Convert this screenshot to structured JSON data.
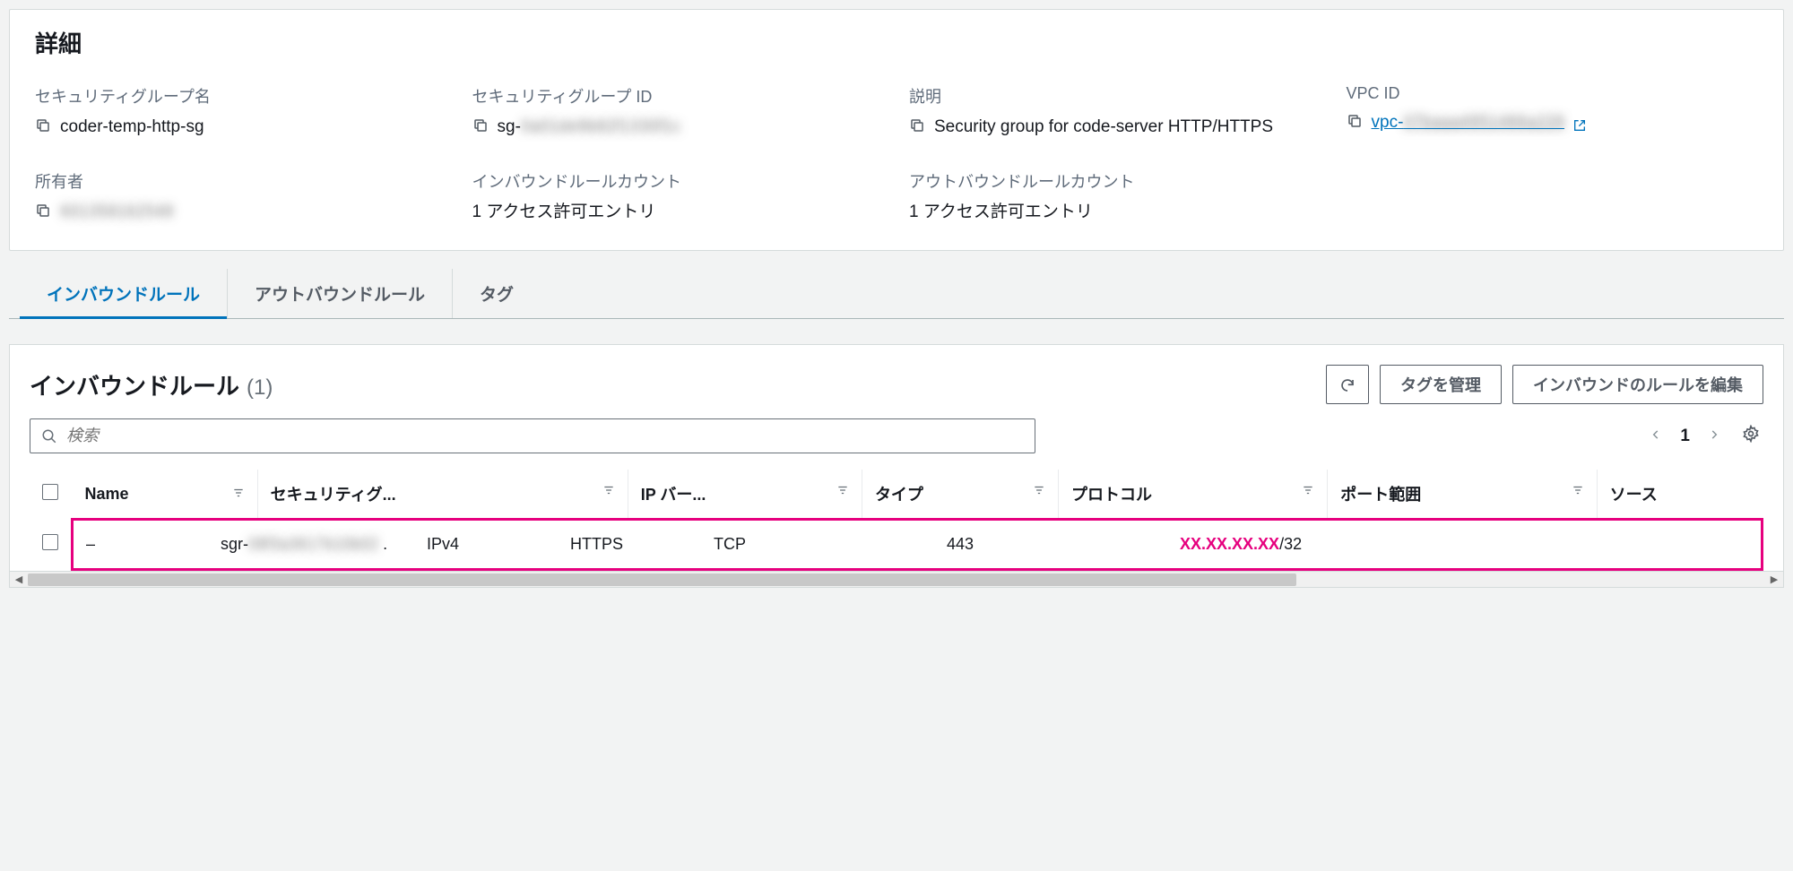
{
  "details": {
    "title": "詳細",
    "fields": {
      "sg_name_label": "セキュリティグループ名",
      "sg_name_value": "coder-temp-http-sg",
      "sg_id_label": "セキュリティグループ ID",
      "sg_id_prefix": "sg-",
      "sg_id_blurred": "0a01de9b82f1330f1c",
      "desc_label": "説明",
      "desc_value": "Security group for code-server HTTP/HTTPS",
      "vpc_label": "VPC ID",
      "vpc_prefix": "vpc-",
      "vpc_blurred": "07baaa4951466a228",
      "owner_label": "所有者",
      "owner_blurred": "601358162548",
      "inbound_count_label": "インバウンドルールカウント",
      "inbound_count_value": "1 アクセス許可エントリ",
      "outbound_count_label": "アウトバウンドルールカウント",
      "outbound_count_value": "1 アクセス許可エントリ"
    }
  },
  "tabs": {
    "inbound": "インバウンドルール",
    "outbound": "アウトバウンドルール",
    "tags": "タグ"
  },
  "rules": {
    "title": "インバウンドルール",
    "count": "(1)",
    "actions": {
      "manage_tags": "タグを管理",
      "edit_rules": "インバウンドのルールを編集"
    },
    "search_placeholder": "検索",
    "page": "1",
    "columns": {
      "name": "Name",
      "sg_rule": "セキュリティグ...",
      "ip_version": "IP バー...",
      "type": "タイプ",
      "protocol": "プロトコル",
      "port_range": "ポート範囲",
      "source": "ソース"
    },
    "rows": [
      {
        "name": "–",
        "sg_rule_prefix": "sgr-",
        "sg_rule_blurred": "08f3a3617b10b02",
        "sg_rule_suffix": ".",
        "ip_version": "IPv4",
        "type": "HTTPS",
        "protocol": "TCP",
        "port_range": "443",
        "source_ip": "XX.XX.XX.XX",
        "source_suffix": "/32"
      }
    ]
  }
}
